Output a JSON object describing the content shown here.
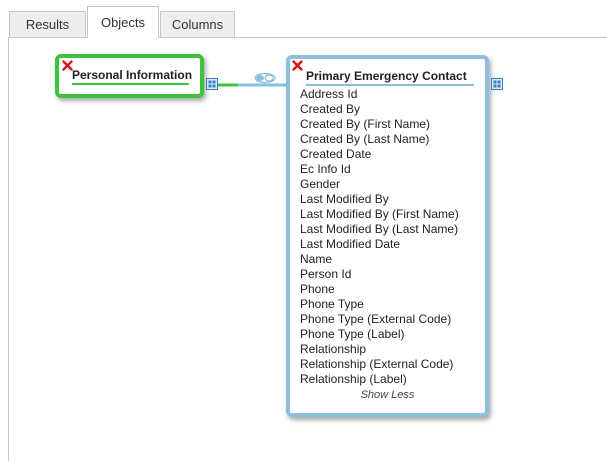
{
  "tabs": [
    {
      "label": "Results",
      "active": false
    },
    {
      "label": "Objects",
      "active": true
    },
    {
      "label": "Columns",
      "active": false
    }
  ],
  "objects": {
    "personal": {
      "title": "Personal Information",
      "border_color": "#3dc43d"
    },
    "contact": {
      "title": "Primary Emergency Contact",
      "border_color": "#8ac0dc",
      "fields": [
        "Address Id",
        "Created By",
        "Created By (First Name)",
        "Created By (Last Name)",
        "Created Date",
        "Ec Info Id",
        "Gender",
        "Last Modified By",
        "Last Modified By (First Name)",
        "Last Modified By (Last Name)",
        "Last Modified Date",
        "Name",
        "Person Id",
        "Phone",
        "Phone Type",
        "Phone Type (External Code)",
        "Phone Type (Label)",
        "Relationship",
        "Relationship (External Code)",
        "Relationship (Label)"
      ],
      "show_less_label": "Show Less"
    }
  },
  "icons": {
    "remove": "close-x-icon",
    "columns": "grid-columns-icon",
    "join": "join-link-icon"
  }
}
